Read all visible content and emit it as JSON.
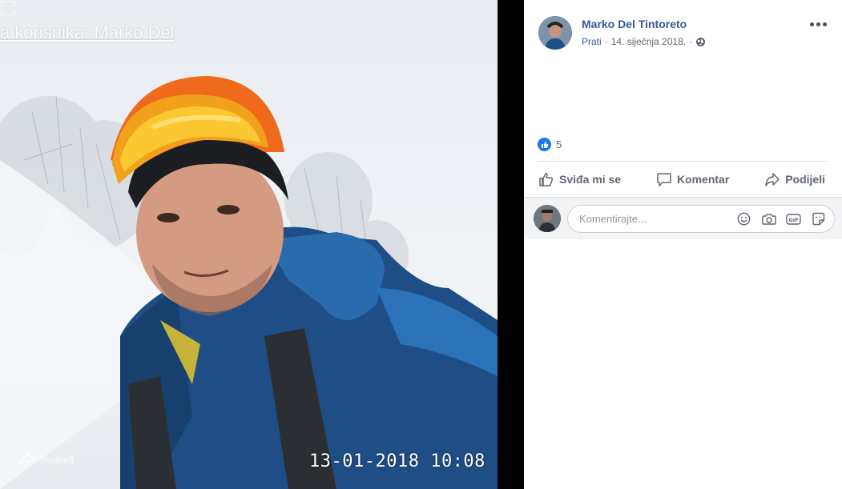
{
  "photo": {
    "title": "a korisnika: Marko Del",
    "share_label": "Podijeli",
    "timestamp": "13-01-2018 10:08"
  },
  "post": {
    "author": "Marko Del Tintoreto",
    "follow_label": "Prati",
    "date": "14. siječnja 2018.",
    "separator": "·",
    "audience_icon": "globe-icon",
    "reaction_count": "5"
  },
  "actions": {
    "like_label": "Sviđa mi se",
    "comment_label": "Komentar",
    "share_label": "Podijeli"
  },
  "comment": {
    "placeholder": "Komentirajte...",
    "icons": [
      "emoji-icon",
      "camera-icon",
      "gif-icon",
      "sticker-icon"
    ]
  },
  "colors": {
    "brand_blue": "#1877f2",
    "link_blue": "#365899",
    "muted": "#606770"
  }
}
